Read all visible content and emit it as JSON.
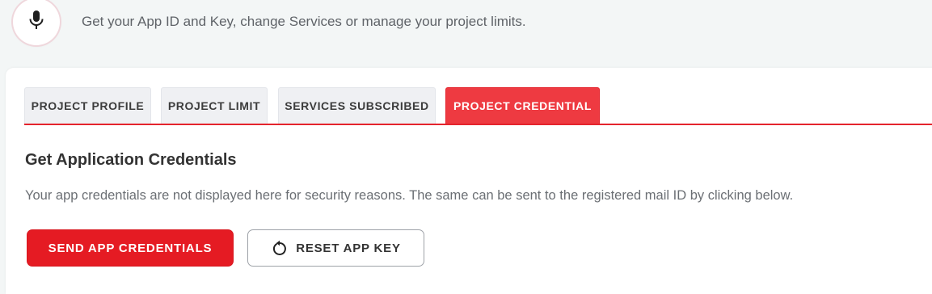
{
  "header": {
    "description": "Get your App ID and Key, change Services or manage your project limits.",
    "icon": "microphone-icon"
  },
  "tabs": [
    {
      "label": "PROJECT PROFILE",
      "active": false
    },
    {
      "label": "PROJECT LIMIT",
      "active": false
    },
    {
      "label": "SERVICES SUBSCRIBED",
      "active": false
    },
    {
      "label": "PROJECT CREDENTIAL",
      "active": true
    }
  ],
  "credentials": {
    "title": "Get Application Credentials",
    "description": "Your app credentials are not displayed here for security reasons. The same can be sent to the registered mail ID by clicking below.",
    "send_button": "SEND APP CREDENTIALS",
    "reset_button": "RESET APP KEY",
    "reset_icon": "reset-icon"
  },
  "colors": {
    "accent": "#e51b23",
    "active_tab": "#ee3a41",
    "page_bg": "#f3f6f6"
  }
}
